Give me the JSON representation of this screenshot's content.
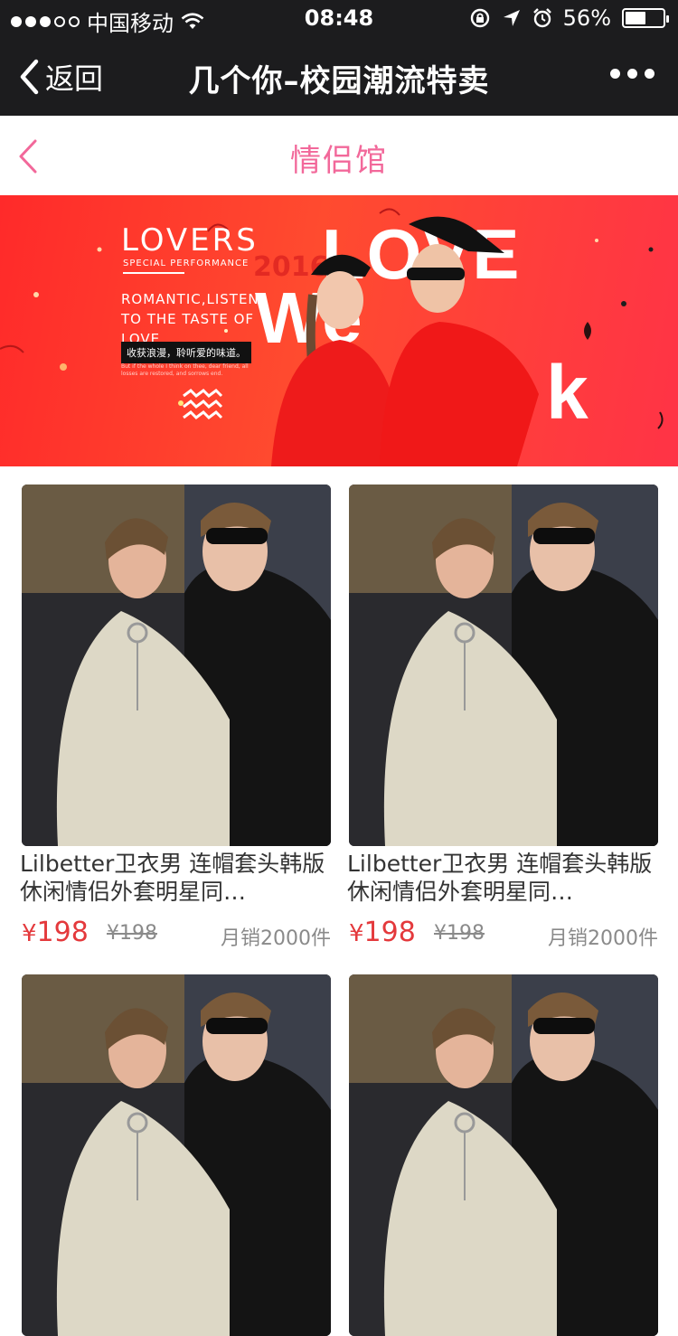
{
  "status_bar": {
    "carrier": "中国移动",
    "time": "08:48",
    "battery": "56%",
    "battery_level": 0.56,
    "signal_bars_filled": 3,
    "signal_bars_total": 5
  },
  "nav": {
    "back_label": "返回",
    "title": "几个你–校园潮流特卖"
  },
  "subheader": {
    "title": "情侣馆"
  },
  "banner": {
    "lovers": "LOVERS",
    "special": "SPECIAL PERFORMANCE",
    "romantic": "ROMANTIC,LISTEN TO THE TASTE OF LOVE.",
    "cn_text": "收获浪漫，聆听爱的味道。",
    "small_text": "But if the whole I think on thee, dear friend, all losses are restored, and sorrows end.",
    "year": "2016",
    "big_love": "LOVE",
    "big_we": "We",
    "big_k": "k"
  },
  "products": [
    {
      "name": "Lilbetter卫衣男 连帽套头韩版休闲情侣外套明星同…",
      "yen": "¥",
      "price": "198",
      "old_price": "¥198",
      "sales": "月销2000件"
    },
    {
      "name": "Lilbetter卫衣男 连帽套头韩版休闲情侣外套明星同…",
      "yen": "¥",
      "price": "198",
      "old_price": "¥198",
      "sales": "月销2000件"
    },
    {
      "name": "",
      "yen": "",
      "price": "",
      "old_price": "",
      "sales": ""
    },
    {
      "name": "",
      "yen": "",
      "price": "",
      "old_price": "",
      "sales": ""
    }
  ],
  "colors": {
    "nav_bg": "#1c1c1e",
    "accent_pink": "#f2689a",
    "price_red": "#e4393c",
    "banner_red": "#ff3a2e"
  }
}
